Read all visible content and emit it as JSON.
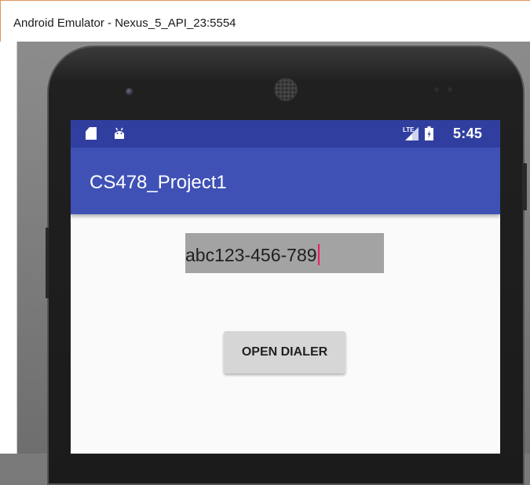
{
  "window": {
    "title": "Android Emulator - Nexus_5_API_23:5554"
  },
  "statusbar": {
    "time": "5:45",
    "network": "LTE",
    "icons": [
      "sd-card-icon",
      "android-debug-icon",
      "lte-signal-icon",
      "battery-icon"
    ]
  },
  "app": {
    "title": "CS478_Project1",
    "phone_field_value": "abc123-456-789",
    "open_dialer_label": "OPEN DIALER"
  },
  "colors": {
    "primary": "#3f51b5",
    "primary_dark": "#303f9f",
    "accent": "#e91e63"
  }
}
